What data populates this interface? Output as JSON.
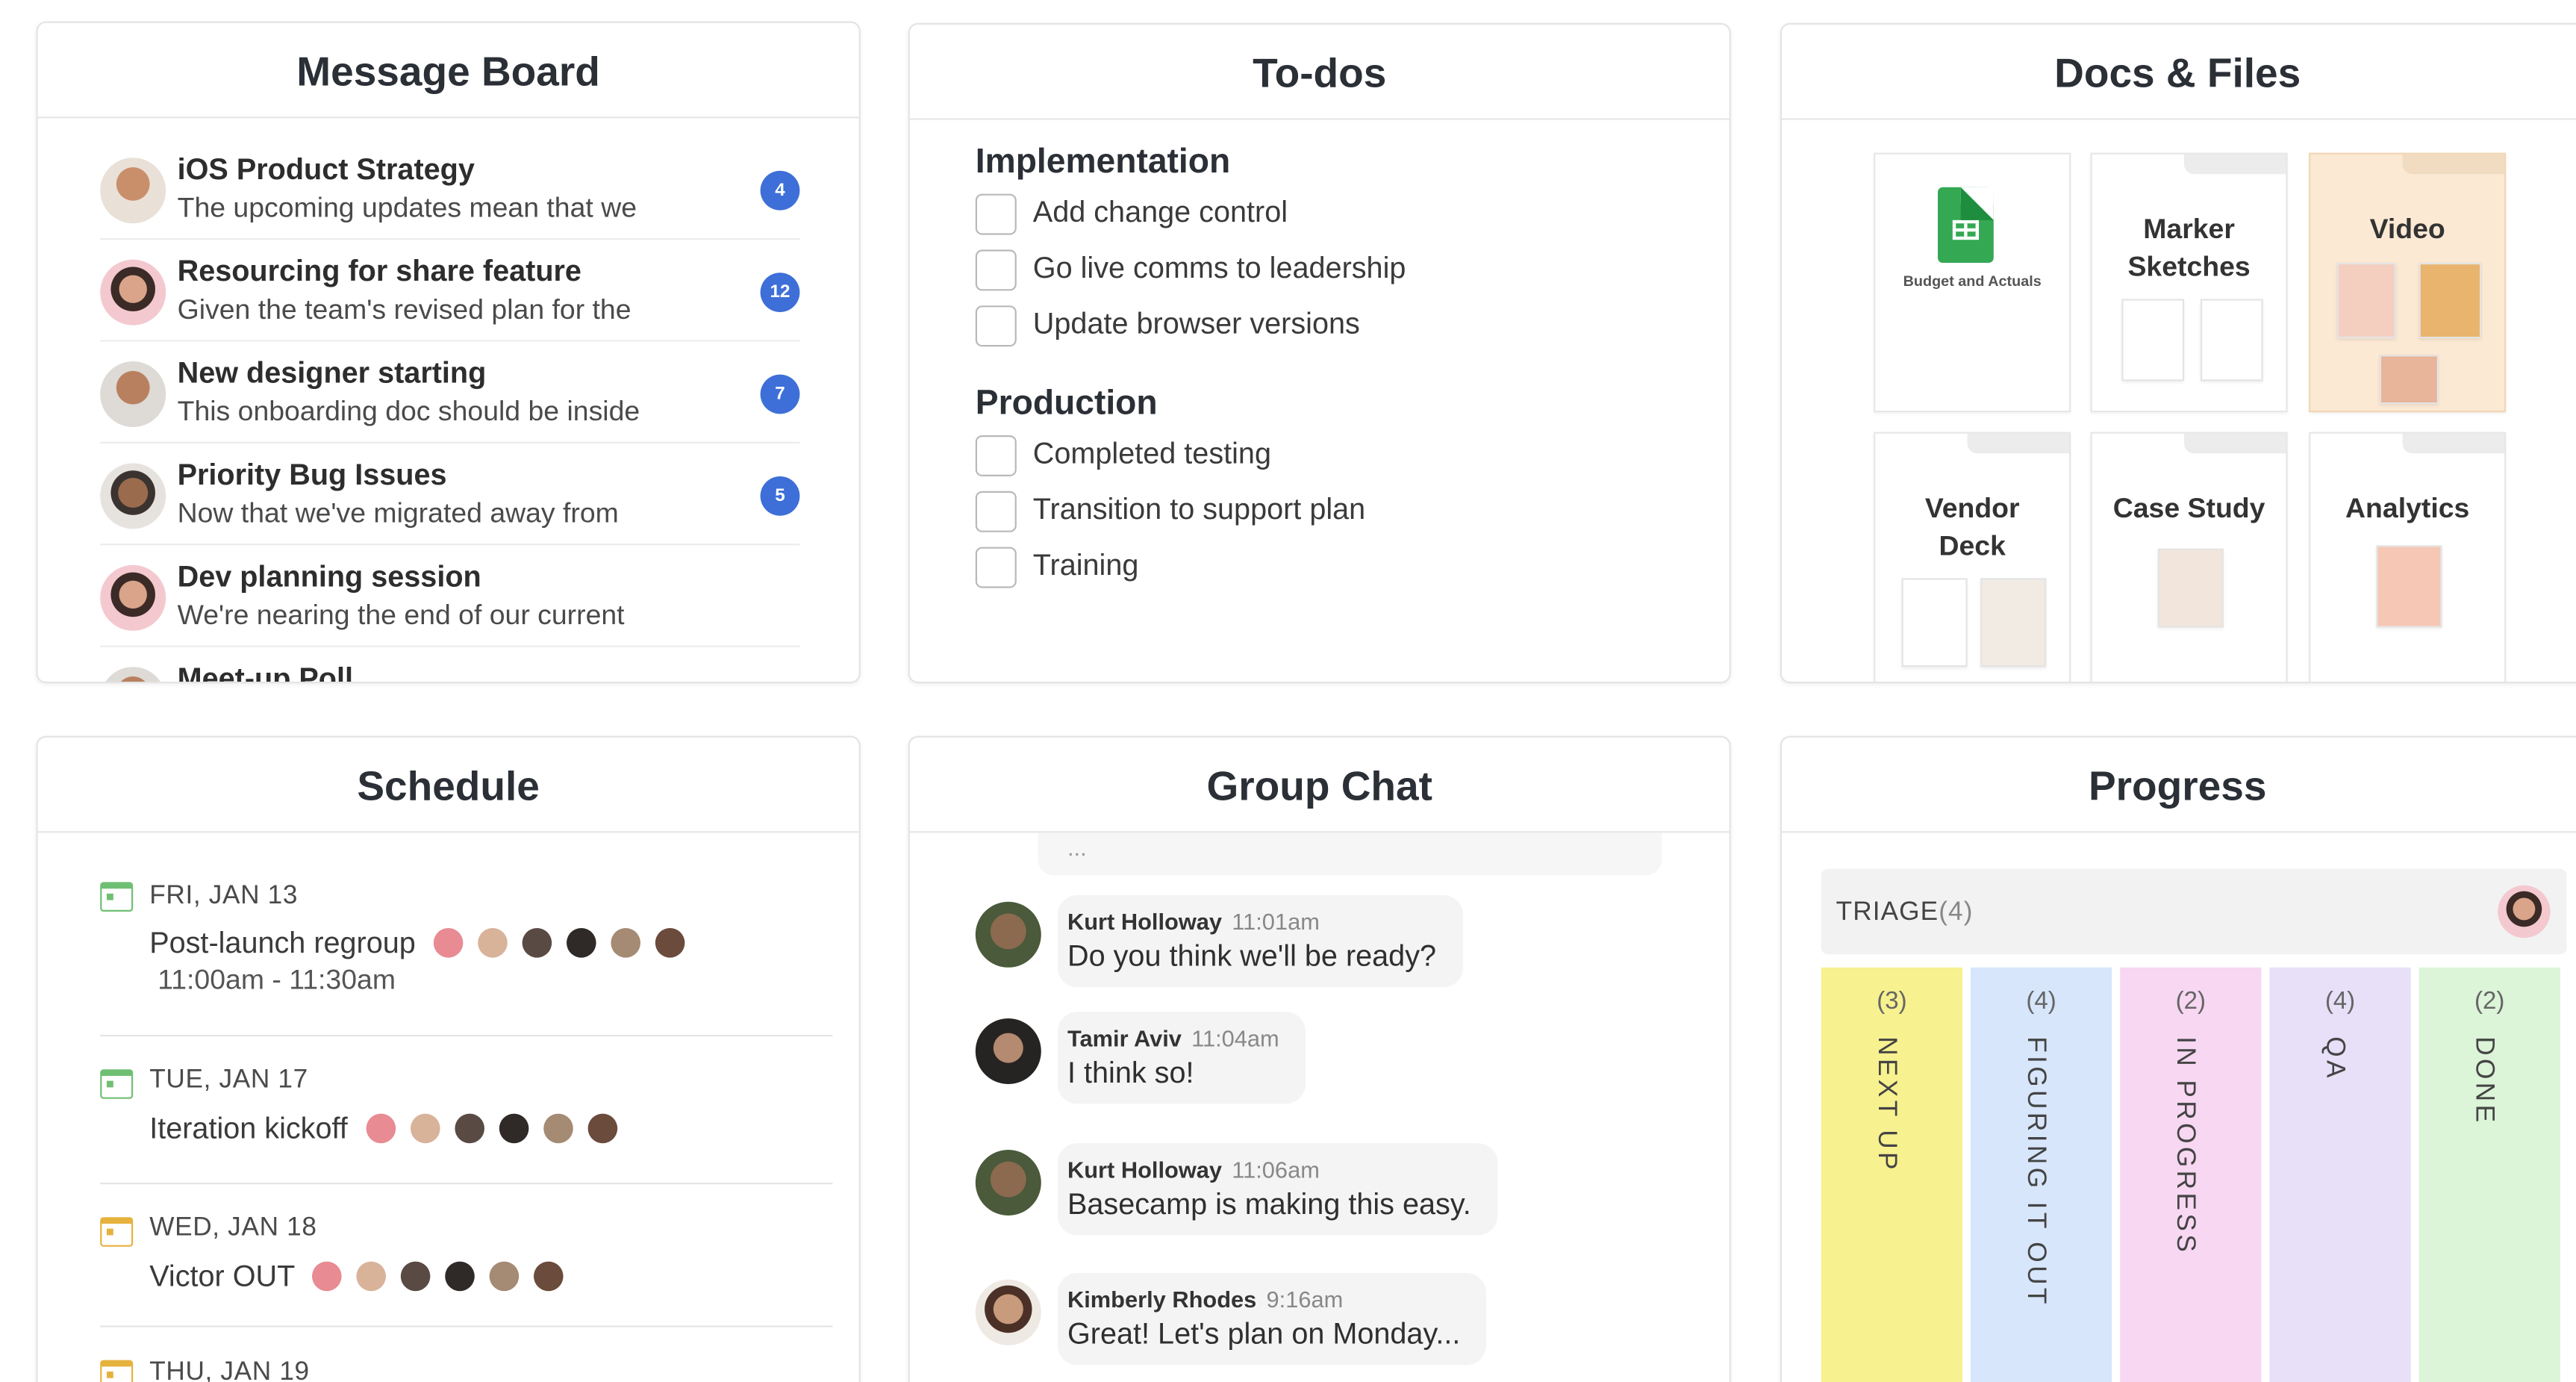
{
  "colors": {
    "badge": "#3e6fd8",
    "video_tile": "#fbe9d4",
    "kanban_next_up": "#f7f18f",
    "kanban_figuring": "#d7e6fb",
    "kanban_in_progress": "#f7d7f2",
    "kanban_qa": "#e7e0f8",
    "kanban_done": "#dcf4d8"
  },
  "message_board": {
    "title": "Message Board",
    "items": [
      {
        "title": "iOS Product Strategy",
        "excerpt": "The upcoming updates mean that we",
        "count": "4"
      },
      {
        "title": "Resourcing for share feature",
        "excerpt": "Given the team's revised plan for the",
        "count": "12"
      },
      {
        "title": "New designer starting",
        "excerpt": "This onboarding doc should be inside",
        "count": "7"
      },
      {
        "title": "Priority Bug Issues",
        "excerpt": "Now that we've migrated away from",
        "count": "5"
      },
      {
        "title": "Dev planning session",
        "excerpt": "We're nearing the end of our current",
        "count": ""
      },
      {
        "title": "Meet-up Poll",
        "excerpt": "",
        "count": ""
      }
    ]
  },
  "todos": {
    "title": "To-dos",
    "groups": [
      {
        "name": "Implementation",
        "items": [
          "Add change control",
          "Go live comms to leadership",
          "Update browser versions"
        ]
      },
      {
        "name": "Production",
        "items": [
          "Completed testing",
          "Transition to support plan",
          "Training"
        ]
      }
    ]
  },
  "docs": {
    "title": "Docs & Files",
    "tiles": [
      {
        "name": "Budget and Actuals",
        "icon": "spreadsheet-icon"
      },
      {
        "name": "Marker Sketches"
      },
      {
        "name": "Video"
      },
      {
        "name": "Vendor Deck"
      },
      {
        "name": "Case Study"
      },
      {
        "name": "Analytics"
      }
    ]
  },
  "schedule": {
    "title": "Schedule",
    "items": [
      {
        "date": "FRI, JAN 13",
        "event": "Post-launch regroup",
        "time": "11:00am - 11:30am"
      },
      {
        "date": "TUE, JAN 17",
        "event": "Iteration kickoff",
        "time": ""
      },
      {
        "date": "WED, JAN 18",
        "event": "Victor OUT",
        "time": ""
      },
      {
        "date": "THU, JAN 19",
        "event": "",
        "time": ""
      }
    ]
  },
  "chat": {
    "title": "Group Chat",
    "top_placeholder": "...",
    "messages": [
      {
        "author": "Kurt Holloway",
        "time": "11:01am",
        "text": "Do you think we'll be ready?"
      },
      {
        "author": "Tamir Aviv",
        "time": "11:04am",
        "text": "I think so!"
      },
      {
        "author": "Kurt Holloway",
        "time": "11:06am",
        "text": "Basecamp is making this easy."
      },
      {
        "author": "Kimberly Rhodes",
        "time": "9:16am",
        "text": "Great! Let's plan on Monday..."
      }
    ]
  },
  "progress": {
    "title": "Progress",
    "triage": {
      "label": "TRIAGE",
      "count": "(4)"
    },
    "columns": [
      {
        "count": "(3)",
        "name": "NEXT UP"
      },
      {
        "count": "(4)",
        "name": "FIGURING IT OUT"
      },
      {
        "count": "(2)",
        "name": "IN PROGRESS"
      },
      {
        "count": "(4)",
        "name": "QA"
      },
      {
        "count": "(2)",
        "name": "DONE"
      }
    ]
  }
}
